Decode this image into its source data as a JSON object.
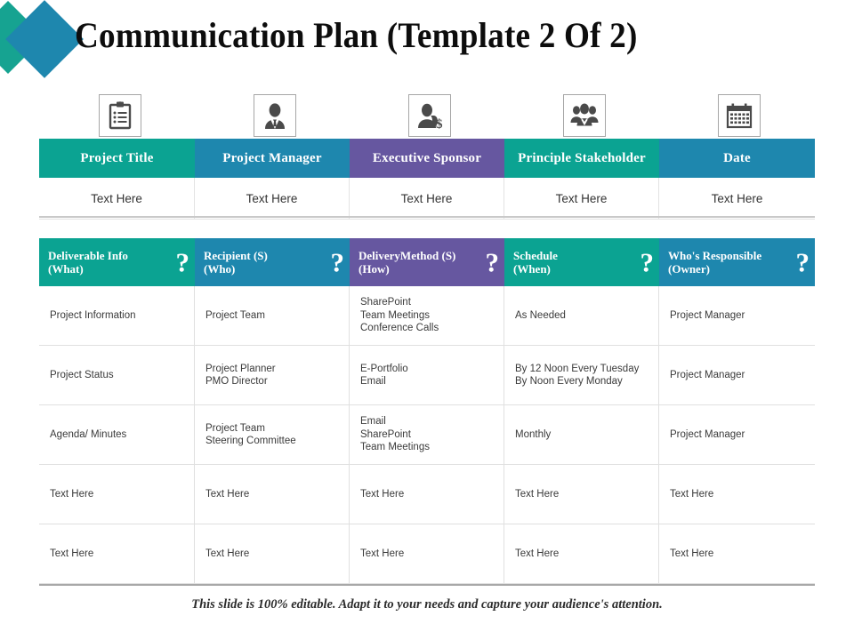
{
  "slide": {
    "title": "Communication Plan (Template 2 Of 2)",
    "footer_note": "This slide is 100% editable. Adapt it to your needs and capture your audience's attention."
  },
  "logo": {
    "shape_1": "diamond-green",
    "shape_2": "diamond-blue",
    "color_green": "#16A391",
    "color_blue": "#1E87AE"
  },
  "palette": {
    "teal": "#0BA392",
    "blue": "#1E87AE",
    "purple": "#6657A0",
    "white": "#FFFFFF",
    "text_dark": "#333333",
    "rule_gray": "#C9C9C9"
  },
  "icon_strip": [
    {
      "name": "clipboard-list-icon",
      "for_column": "Project Title"
    },
    {
      "name": "businessman-icon",
      "for_column": "Project Manager"
    },
    {
      "name": "person-dollar-icon",
      "for_column": "Executive Sponsor"
    },
    {
      "name": "people-group-icon",
      "for_column": "Principle Stakeholder"
    },
    {
      "name": "calendar-icon",
      "for_column": "Date"
    }
  ],
  "project_table": {
    "headers": [
      {
        "label": "Project Title",
        "color": "#0BA392"
      },
      {
        "label": "Project Manager",
        "color": "#1E87AE"
      },
      {
        "label": "Executive Sponsor",
        "color": "#6657A0"
      },
      {
        "label": "Principle Stakeholder",
        "color": "#0BA392"
      },
      {
        "label": "Date",
        "color": "#1E87AE"
      }
    ],
    "row": [
      "Text Here",
      "Text Here",
      "Text Here",
      "Text Here",
      "Text Here"
    ]
  },
  "plan_table": {
    "headers": [
      {
        "line1": "Deliverable Info",
        "line2": "(What)",
        "color": "#0BA392",
        "icon": "question-mark-icon"
      },
      {
        "line1": "Recipient (S)",
        "line2": "(Who)",
        "color": "#1E87AE",
        "icon": "question-mark-icon"
      },
      {
        "line1": "DeliveryMethod (S)",
        "line2": "(How)",
        "color": "#6657A0",
        "icon": "question-mark-icon"
      },
      {
        "line1": "Schedule",
        "line2": "(When)",
        "color": "#0BA392",
        "icon": "question-mark-icon"
      },
      {
        "line1": "Who's Responsible",
        "line2": "(Owner)",
        "color": "#1E87AE",
        "icon": "question-mark-icon"
      }
    ],
    "question_mark": "?",
    "rows": [
      {
        "what": [
          "Project Information"
        ],
        "who": [
          "Project Team"
        ],
        "how": [
          "SharePoint",
          "Team Meetings",
          "Conference Calls"
        ],
        "when": [
          "As Needed"
        ],
        "owner": [
          "Project Manager"
        ]
      },
      {
        "what": [
          "Project Status"
        ],
        "who": [
          "Project Planner",
          "PMO  Director"
        ],
        "how": [
          "E-Portfolio",
          "Email"
        ],
        "when": [
          "By 12 Noon Every  Tuesday",
          "By Noon Every  Monday"
        ],
        "owner": [
          "Project Manager"
        ]
      },
      {
        "what": [
          "Agenda/ Minutes"
        ],
        "who": [
          "Project Team",
          "Steering Committee"
        ],
        "how": [
          "Email",
          "SharePoint",
          "Team Meetings"
        ],
        "when": [
          "Monthly"
        ],
        "owner": [
          "Project Manager"
        ]
      },
      {
        "what": [
          "Text Here"
        ],
        "who": [
          "Text Here"
        ],
        "how": [
          "Text Here"
        ],
        "when": [
          "Text Here"
        ],
        "owner": [
          "Text Here"
        ]
      },
      {
        "what": [
          "Text Here"
        ],
        "who": [
          "Text Here"
        ],
        "how": [
          "Text Here"
        ],
        "when": [
          "Text Here"
        ],
        "owner": [
          "Text Here"
        ]
      }
    ]
  }
}
